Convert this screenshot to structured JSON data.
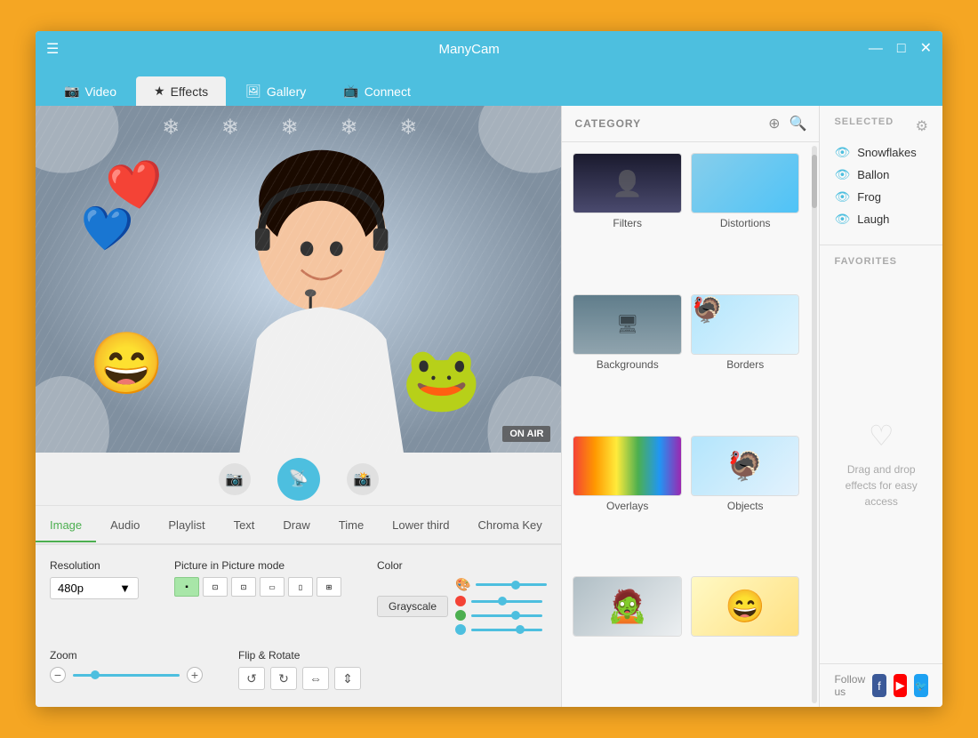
{
  "app": {
    "title": "ManyCam",
    "menu_icon": "☰"
  },
  "titlebar": {
    "minimize": "—",
    "maximize": "□",
    "close": "✕"
  },
  "nav": {
    "tabs": [
      {
        "id": "video",
        "label": "Video",
        "icon": "📷",
        "active": false
      },
      {
        "id": "effects",
        "label": "Effects",
        "icon": "★",
        "active": true
      },
      {
        "id": "gallery",
        "label": "Gallery",
        "icon": "🖼",
        "active": false
      },
      {
        "id": "connect",
        "label": "Connect",
        "icon": "📺",
        "active": false
      }
    ]
  },
  "video": {
    "on_air": "ON AIR",
    "effects": [
      "❤",
      "💙",
      "😄",
      "🐸"
    ]
  },
  "camera_controls": {
    "cam_icon": "📷",
    "broadcast_icon": "📡",
    "snapshot_icon": "📷"
  },
  "bottom_tabs": [
    {
      "id": "image",
      "label": "Image",
      "active": true
    },
    {
      "id": "audio",
      "label": "Audio",
      "active": false
    },
    {
      "id": "playlist",
      "label": "Playlist",
      "active": false
    },
    {
      "id": "text",
      "label": "Text",
      "active": false
    },
    {
      "id": "draw",
      "label": "Draw",
      "active": false
    },
    {
      "id": "time",
      "label": "Time",
      "active": false
    },
    {
      "id": "lower_third",
      "label": "Lower third",
      "active": false
    },
    {
      "id": "chroma_key",
      "label": "Chroma Key",
      "active": false
    }
  ],
  "settings": {
    "resolution_label": "Resolution",
    "resolution_value": "480p",
    "pip_label": "Picture in Picture mode",
    "color_label": "Color",
    "grayscale_btn": "Grayscale",
    "zoom_label": "Zoom",
    "flip_label": "Flip & Rotate"
  },
  "category": {
    "title": "CATEGORY",
    "add_btn": "+",
    "search_btn": "🔍",
    "items": [
      {
        "id": "filters",
        "label": "Filters"
      },
      {
        "id": "distortions",
        "label": "Distortions"
      },
      {
        "id": "backgrounds",
        "label": "Backgrounds"
      },
      {
        "id": "borders",
        "label": "Borders"
      },
      {
        "id": "overlays",
        "label": "Overlays"
      },
      {
        "id": "objects",
        "label": "Objects"
      },
      {
        "id": "faces1",
        "label": ""
      },
      {
        "id": "faces2",
        "label": ""
      }
    ]
  },
  "right_panel": {
    "selected_title": "SELECTED",
    "filter_icon": "⚙",
    "selected_items": [
      {
        "label": "Snowflakes"
      },
      {
        "label": "Ballon"
      },
      {
        "label": "Frog"
      },
      {
        "label": "Laugh"
      }
    ],
    "favorites_title": "FAVORITES",
    "heart_icon": "♡",
    "drop_text": "Drag and drop effects for easy access",
    "follow_label": "Follow us"
  },
  "social": [
    {
      "id": "facebook",
      "label": "f",
      "color": "fb"
    },
    {
      "id": "youtube",
      "label": "▶",
      "color": "yt"
    },
    {
      "id": "twitter",
      "label": "🐦",
      "color": "tw"
    }
  ]
}
